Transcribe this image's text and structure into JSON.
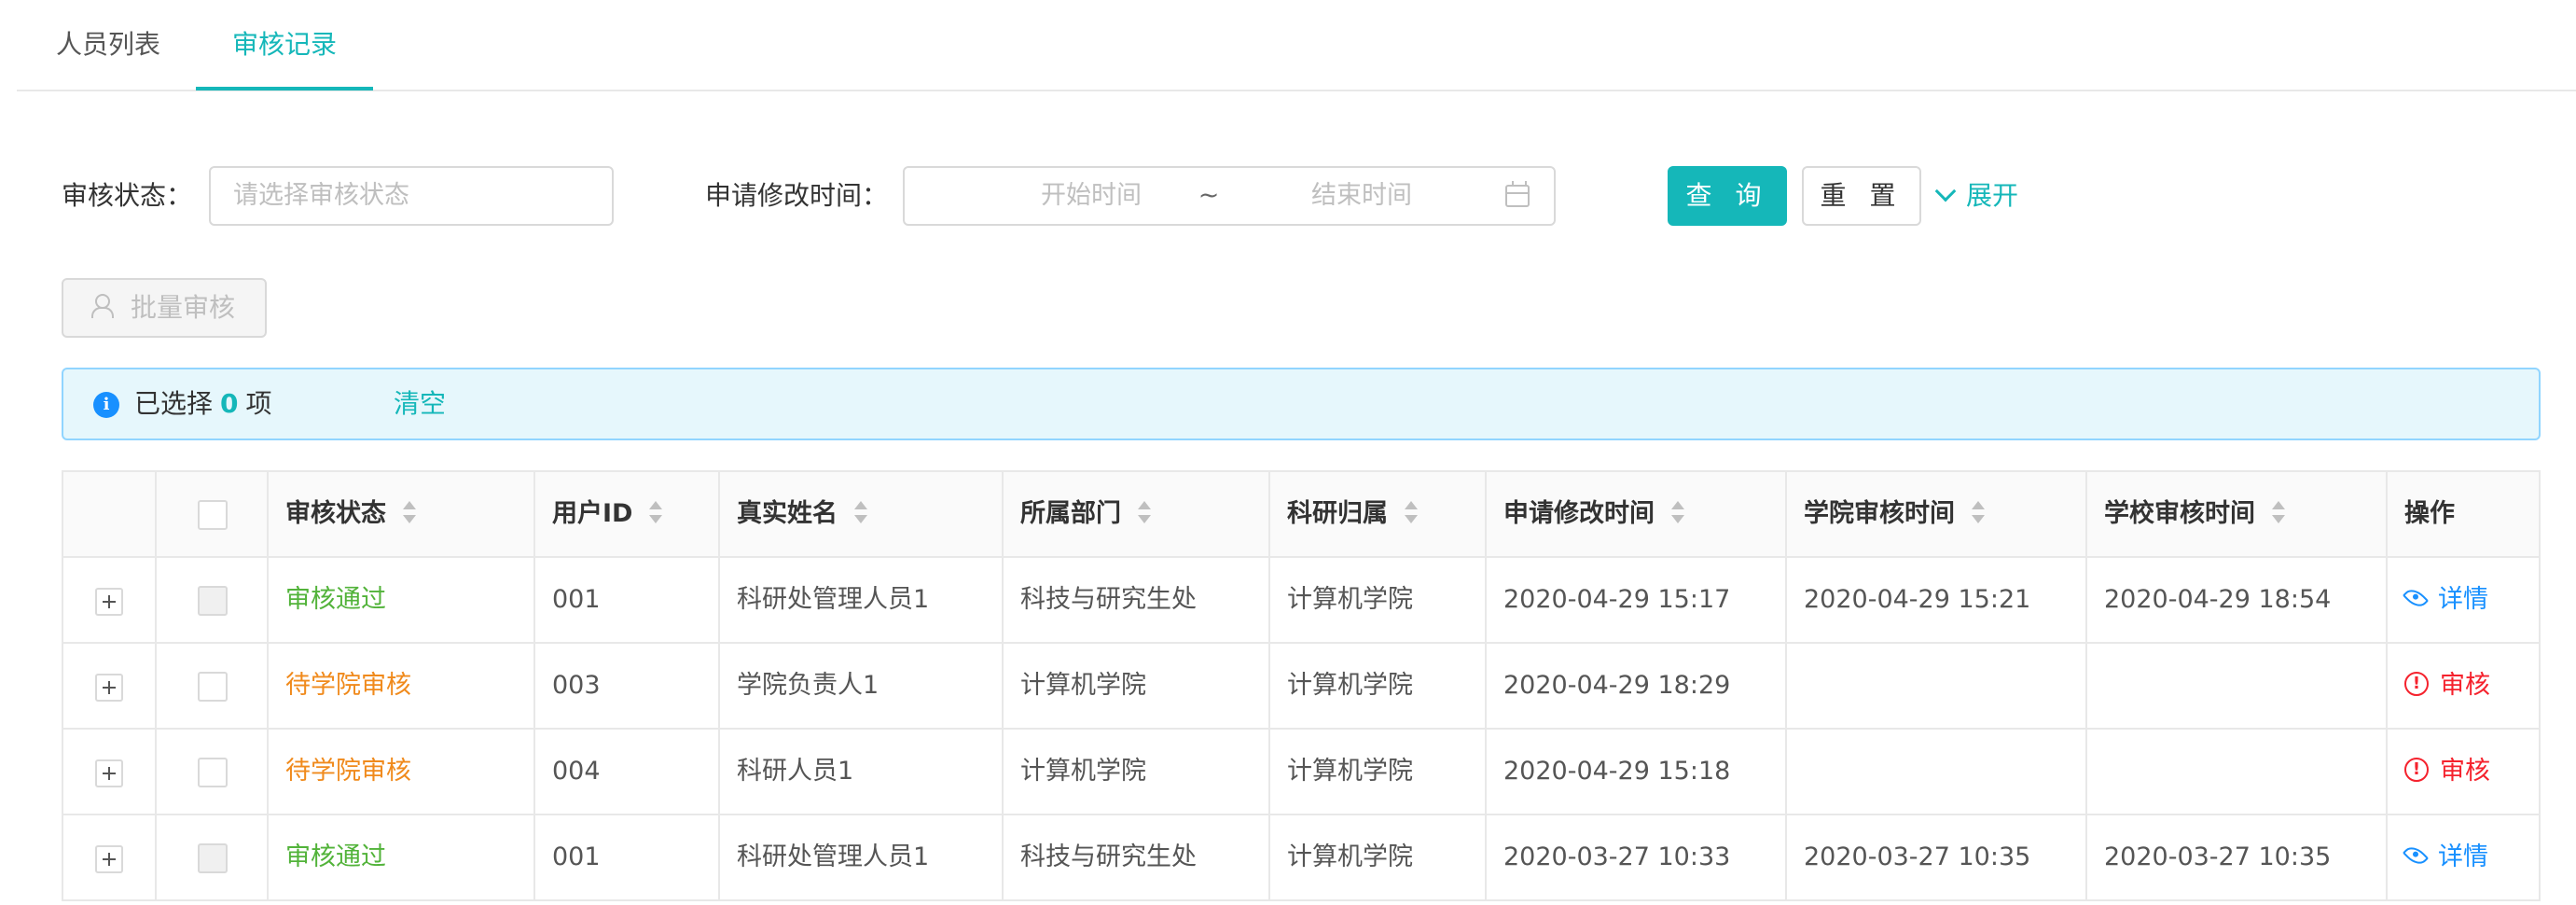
{
  "tabs": [
    {
      "label": "人员列表",
      "active": false
    },
    {
      "label": "审核记录",
      "active": true
    }
  ],
  "filters": {
    "status_label": "审核状态：",
    "status_placeholder": "请选择审核状态",
    "time_label": "申请修改时间：",
    "start_placeholder": "开始时间",
    "separator": "~",
    "end_placeholder": "结束时间",
    "query_label": "查 询",
    "reset_label": "重 置",
    "expand_label": "展开"
  },
  "batch_button": {
    "label": "批量审核",
    "disabled": true
  },
  "alert": {
    "prefix": "已选择",
    "count": "0",
    "suffix": "项",
    "clear_label": "清空"
  },
  "table": {
    "columns": [
      "审核状态",
      "用户ID",
      "真实姓名",
      "所属部门",
      "科研归属",
      "申请修改时间",
      "学院审核时间",
      "学校审核时间",
      "操作"
    ],
    "rows": [
      {
        "status": "审核通过",
        "status_type": "pass",
        "user_id": "001",
        "name": "科研处管理人员1",
        "dept": "科技与研究生处",
        "research": "计算机学院",
        "apply_time": "2020-04-29 15:17",
        "college_time": "2020-04-29 15:21",
        "school_time": "2020-04-29 18:54",
        "action": "详情",
        "action_type": "detail",
        "checkbox_disabled": true
      },
      {
        "status": "待学院审核",
        "status_type": "wait",
        "user_id": "003",
        "name": "学院负责人1",
        "dept": "计算机学院",
        "research": "计算机学院",
        "apply_time": "2020-04-29 18:29",
        "college_time": "",
        "school_time": "",
        "action": "审核",
        "action_type": "review",
        "checkbox_disabled": false
      },
      {
        "status": "待学院审核",
        "status_type": "wait",
        "user_id": "004",
        "name": "科研人员1",
        "dept": "计算机学院",
        "research": "计算机学院",
        "apply_time": "2020-04-29 15:18",
        "college_time": "",
        "school_time": "",
        "action": "审核",
        "action_type": "review",
        "checkbox_disabled": false
      },
      {
        "status": "审核通过",
        "status_type": "pass",
        "user_id": "001",
        "name": "科研处管理人员1",
        "dept": "科技与研究生处",
        "research": "计算机学院",
        "apply_time": "2020-03-27 10:33",
        "college_time": "2020-03-27 10:35",
        "school_time": "2020-03-27 10:35",
        "action": "详情",
        "action_type": "detail",
        "checkbox_disabled": true
      }
    ]
  },
  "colors": {
    "accent": "#15b7b9",
    "pass": "#52b33a",
    "wait": "#f08a1c",
    "detail": "#1890ff",
    "review": "#f5222d"
  },
  "icons": {
    "batch": "user-check-icon",
    "info": "info-circle-icon",
    "calendar": "calendar-icon",
    "expand": "chevron-down-icon",
    "detail": "eye-icon",
    "review": "exclamation-circle-icon",
    "row_expand": "plus-square-icon"
  }
}
